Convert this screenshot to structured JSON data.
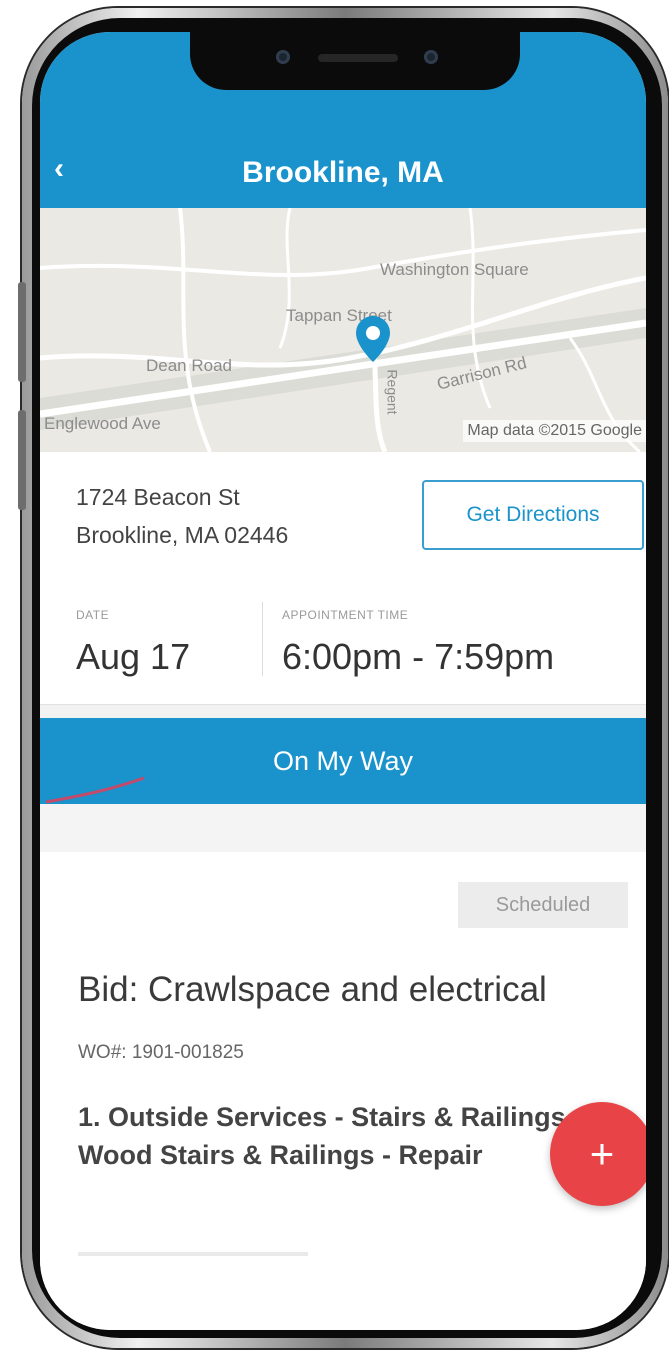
{
  "header": {
    "back_icon": "‹",
    "title": "Brookline, MA"
  },
  "map": {
    "labels": {
      "washington": "Washington Square",
      "tappan": "Tappan Street",
      "dean": "Dean Road",
      "garrison": "Garrison Rd",
      "englewood": "Englewood Ave",
      "regent": "Regent"
    },
    "credit": "Map data ©2015 Google",
    "pin_color": "#1a93cc"
  },
  "address": {
    "line1": "1724 Beacon St",
    "line2": "Brookline, MA 02446",
    "directions_label": "Get Directions"
  },
  "schedule": {
    "date_label": "DATE",
    "date_value": "Aug 17",
    "time_label": "APPOINTMENT TIME",
    "time_value": "6:00pm - 7:59pm"
  },
  "on_my_way_label": "On My Way",
  "work_order": {
    "status": "Scheduled",
    "title": "Bid: Crawlspace and electrical",
    "wo_number": "WO#: 1901-001825",
    "service": "1. Outside Services - Stairs & Railings - Wood Stairs & Railings - Repair"
  },
  "fab_label": "+",
  "colors": {
    "primary": "#1a93cc",
    "fab": "#e84448"
  }
}
